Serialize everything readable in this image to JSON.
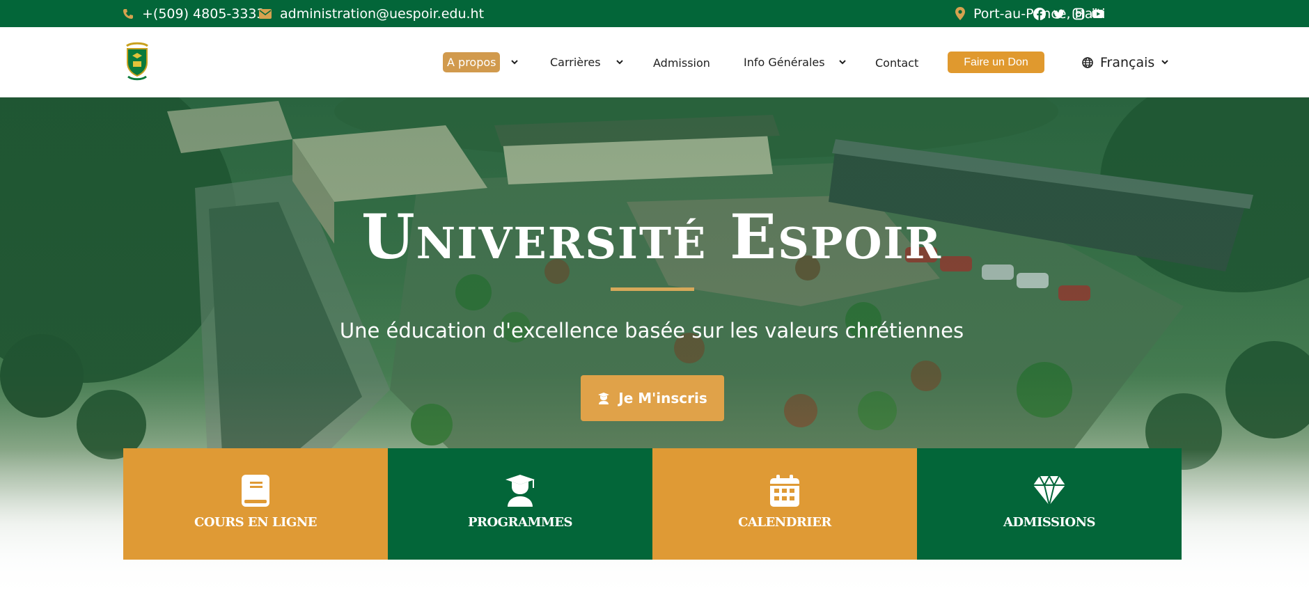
{
  "topbar": {
    "phone": "+(509) 4805-3333",
    "email": "administration@uespoir.edu.ht",
    "location": "Port-au-Prince, Haïti",
    "phone_icon": "phone-icon",
    "email_icon": "envelope-icon",
    "location_icon": "map-marker-icon",
    "social": [
      "facebook-icon",
      "twitter-icon",
      "instagram-icon",
      "youtube-icon"
    ]
  },
  "header": {
    "logo_text": "UNIVERSITÉ ESPOIR",
    "nav": {
      "apropos": "A propos",
      "carrieres": "Carrières",
      "admission": "Admission",
      "info": "Info Générales",
      "contact": "Contact"
    },
    "donate_label": "Faire un Don",
    "language": "Français"
  },
  "hero": {
    "title": "Université Espoir",
    "subtitle": "Une éducation d'excellence basée sur les valeurs chrétiennes",
    "cta_label": "Je M'inscris"
  },
  "tiles": [
    {
      "label": "COURS EN LIGNE",
      "icon": "book-icon"
    },
    {
      "label": "PROGRAMMES",
      "icon": "graduate-icon"
    },
    {
      "label": "CALENDRIER",
      "icon": "calendar-icon"
    },
    {
      "label": "ADMISSIONS",
      "icon": "diamond-icon"
    }
  ],
  "colors": {
    "brand_green": "#036639",
    "accent_orange": "#e0992e",
    "title_rule": "#d6a85a",
    "nav_active": "#d19a4d"
  }
}
